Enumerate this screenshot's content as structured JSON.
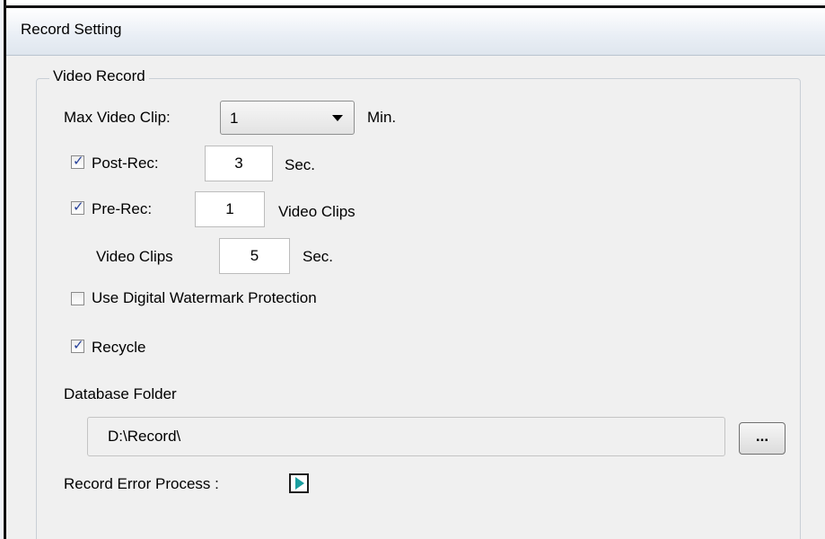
{
  "window": {
    "title": "Record Setting"
  },
  "group": {
    "legend": "Video Record"
  },
  "max_video_clip": {
    "label": "Max Video Clip:",
    "selected": "1",
    "unit": "Min."
  },
  "post_rec": {
    "label": "Post-Rec:",
    "checked": true,
    "value": "3",
    "unit": "Sec."
  },
  "pre_rec": {
    "label": "Pre-Rec:",
    "checked": true,
    "value": "1",
    "unit": "Video Clips"
  },
  "video_clips": {
    "label": "Video Clips",
    "value": "5",
    "unit": "Sec."
  },
  "watermark": {
    "label": "Use Digital Watermark Protection",
    "checked": false
  },
  "recycle": {
    "label": "Recycle",
    "checked": true
  },
  "database_folder": {
    "label": "Database Folder",
    "path": "D:\\Record\\",
    "browse_label": "..."
  },
  "record_error": {
    "label": "Record Error Process :",
    "icon": "play-icon"
  },
  "colors": {
    "checkmark": "#27419a",
    "play_icon": "#1a9fa0"
  }
}
